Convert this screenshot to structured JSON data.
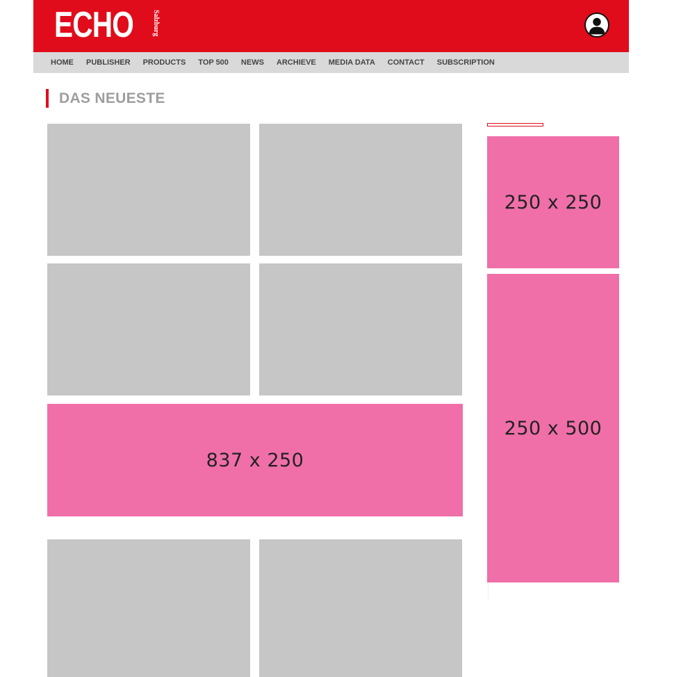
{
  "header": {
    "logo_main": "ECHO",
    "logo_sub": "Salzburg",
    "brand_color": "#e10c1b",
    "user_icon": "user-avatar-icon"
  },
  "nav": {
    "items": [
      "HOME",
      "PUBLISHER",
      "PRODUCTS",
      "TOP 500",
      "NEWS",
      "ARCHIEVE",
      "MEDIA DATA",
      "CONTACT",
      "SUBSCRIPTION"
    ]
  },
  "section": {
    "title": "DAS NEUESTE"
  },
  "ads": {
    "banner": "837 x 250",
    "sidebar_square": "250 x 250",
    "sidebar_tall": "250 x 500",
    "ad_color": "#f06fa9",
    "placeholder_color": "#c6c6c6"
  }
}
